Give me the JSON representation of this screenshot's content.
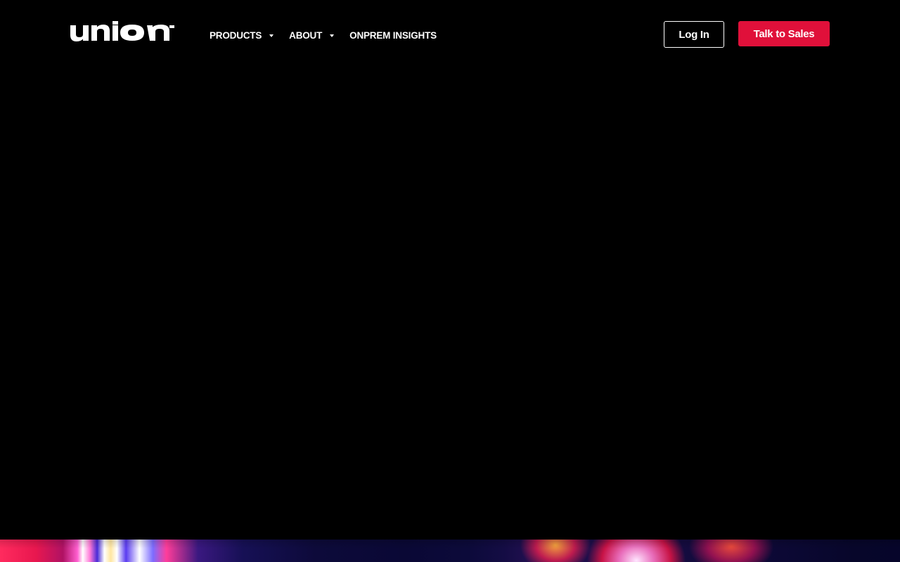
{
  "brand": {
    "name": "union",
    "logo_icon": "union-wordmark-logo",
    "accent_color": "#e0103a"
  },
  "nav": {
    "items": [
      {
        "label": "PRODUCTS",
        "has_dropdown": true
      },
      {
        "label": "ABOUT",
        "has_dropdown": true
      },
      {
        "label": "ONPREM INSIGHTS",
        "has_dropdown": false
      }
    ]
  },
  "actions": {
    "login_label": "Log In",
    "sales_label": "Talk to Sales"
  }
}
